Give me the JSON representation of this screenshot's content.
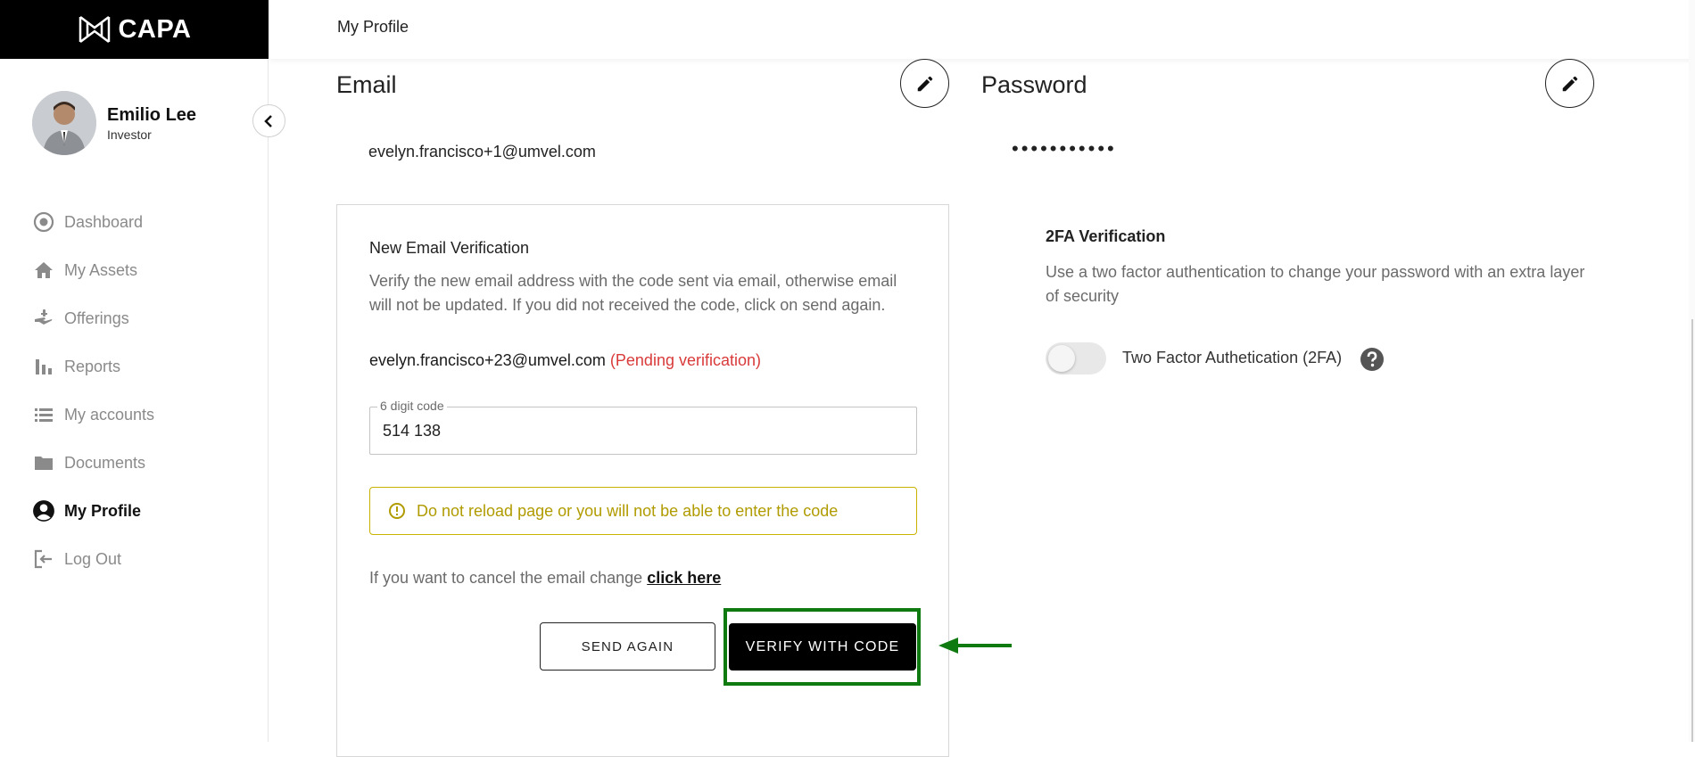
{
  "brand": {
    "name": "CAPA"
  },
  "user": {
    "name": "Emilio Lee",
    "role": "Investor"
  },
  "nav": {
    "items": [
      {
        "label": "Dashboard",
        "icon": "dashboard-icon"
      },
      {
        "label": "My Assets",
        "icon": "home-icon"
      },
      {
        "label": "Offerings",
        "icon": "offering-hand-icon"
      },
      {
        "label": "Reports",
        "icon": "bar-chart-icon"
      },
      {
        "label": "My accounts",
        "icon": "list-icon"
      },
      {
        "label": "Documents",
        "icon": "folder-icon"
      },
      {
        "label": "My Profile",
        "icon": "account-circle-icon",
        "active": true
      },
      {
        "label": "Log Out",
        "icon": "logout-icon"
      }
    ]
  },
  "header": {
    "title": "My Profile"
  },
  "email": {
    "title": "Email",
    "value": "evelyn.francisco+1@umvel.com"
  },
  "password": {
    "title": "Password",
    "masked": "•••••••••••"
  },
  "verification": {
    "title": "New Email Verification",
    "description": "Verify the new email address with the code sent via email, otherwise email will not be updated. If you did not received the code, click on send again.",
    "pending_email": "evelyn.francisco+23@umvel.com",
    "pending_status": "(Pending verification)",
    "code_label": "6 digit code",
    "code_value": "514 138",
    "warning": "Do not reload page or you will not be able to enter the code",
    "cancel_prefix": "If you want to cancel the email change",
    "cancel_link": "click here",
    "send_again": "SEND AGAIN",
    "verify": "VERIFY WITH CODE"
  },
  "twofa": {
    "title": "2FA Verification",
    "description": "Use a two factor authentication to change your password with an extra layer of security",
    "toggle_label": "Two Factor Authetication (2FA)",
    "enabled": false
  },
  "colors": {
    "brand_bg": "#000000",
    "pending": "#d93a3a",
    "warning": "#b09b00",
    "annotation": "#0f7a0f"
  }
}
